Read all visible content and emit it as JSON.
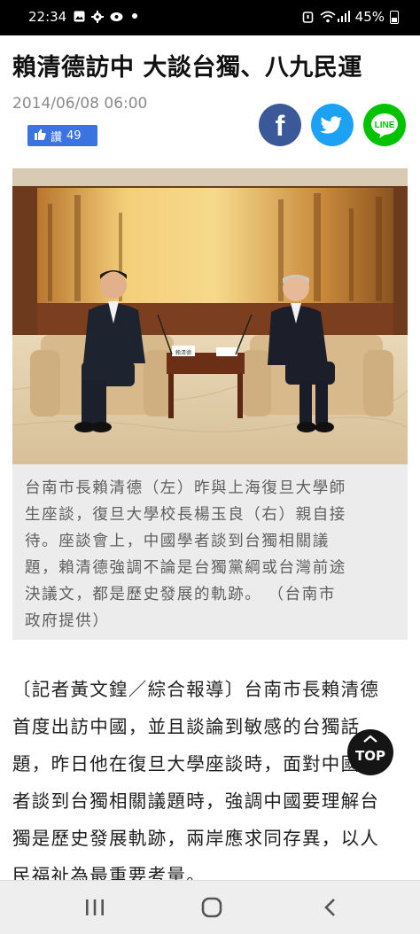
{
  "status_bar": {
    "time": "22:34",
    "battery_percent": "45%",
    "icons_left": [
      "image-icon",
      "gear-icon",
      "cloud-icon",
      "dot-icon"
    ],
    "icons_right": [
      "alarm-icon",
      "wifi-icon",
      "signal-icon",
      "battery-icon"
    ]
  },
  "article": {
    "headline": "賴清德訪中 大談台獨、八九民運",
    "date": "2014/06/08 06:00",
    "like_label": "讚",
    "like_count": "49",
    "share": {
      "facebook_glyph": "f",
      "line_label": "LINE"
    },
    "photo_placard": "賴清德",
    "caption_lines": [
      "台南市長賴清德（左）昨與上海復旦大學師",
      "生座談，復旦大學校長楊玉良（右）親自接",
      "待。座談會上，中國學者談到台獨相關議",
      "題，賴清德強調不論是台獨黨綱或台灣前途",
      "決議文，都是歷史發展的軌跡。 （台南市",
      "政府提供）"
    ],
    "body_lines": [
      "〔記者黃文鍠／綜合報導〕台南市長賴清德",
      "首度出訪中國，並且談論到敏感的台獨話",
      "題，昨日他在復旦大學座談時，面對中國學",
      "者談到台獨相關議題時，強調中國要理解台",
      "獨是歷史發展軌跡，兩岸應求同存異，以人",
      "民福祉為最重要考量。"
    ]
  },
  "top_button": {
    "label": "TOP"
  },
  "nav_bar": {
    "buttons": [
      "recent-apps",
      "home",
      "back"
    ]
  },
  "colors": {
    "like_blue": "#3b73e0",
    "facebook": "#3b5998",
    "twitter": "#1da1f2",
    "line": "#00c300",
    "caption_bg": "#ececec"
  }
}
